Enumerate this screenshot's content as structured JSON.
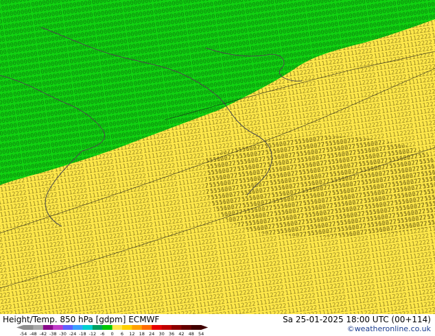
{
  "header": {
    "title": "Height/Temp. 850 hPa [gdpm] ECMWF",
    "datetime": "Sa 25-01-2025 18:00 UTC (00+114)",
    "credit": "©weatheronline.co.uk"
  },
  "legend": {
    "ticks": [
      "-54",
      "-48",
      "-42",
      "-38",
      "-30",
      "-24",
      "-18",
      "-12",
      "-6",
      "0",
      "6",
      "12",
      "18",
      "24",
      "30",
      "36",
      "42",
      "48",
      "54"
    ],
    "colors": [
      "#8e8e8e",
      "#a8a8a8",
      "#8a0a8a",
      "#c03cc8",
      "#6060ff",
      "#3ca0ff",
      "#00d0d0",
      "#00a060",
      "#00c800",
      "#ffe84a",
      "#ffd000",
      "#ffa000",
      "#ff6a00",
      "#e80000",
      "#c00000",
      "#8c0000",
      "#640000",
      "#400000"
    ]
  },
  "map": {
    "cold_color": "#10d210",
    "warm_color": "#ffe84a",
    "coast_color": "#4a4a4a"
  }
}
